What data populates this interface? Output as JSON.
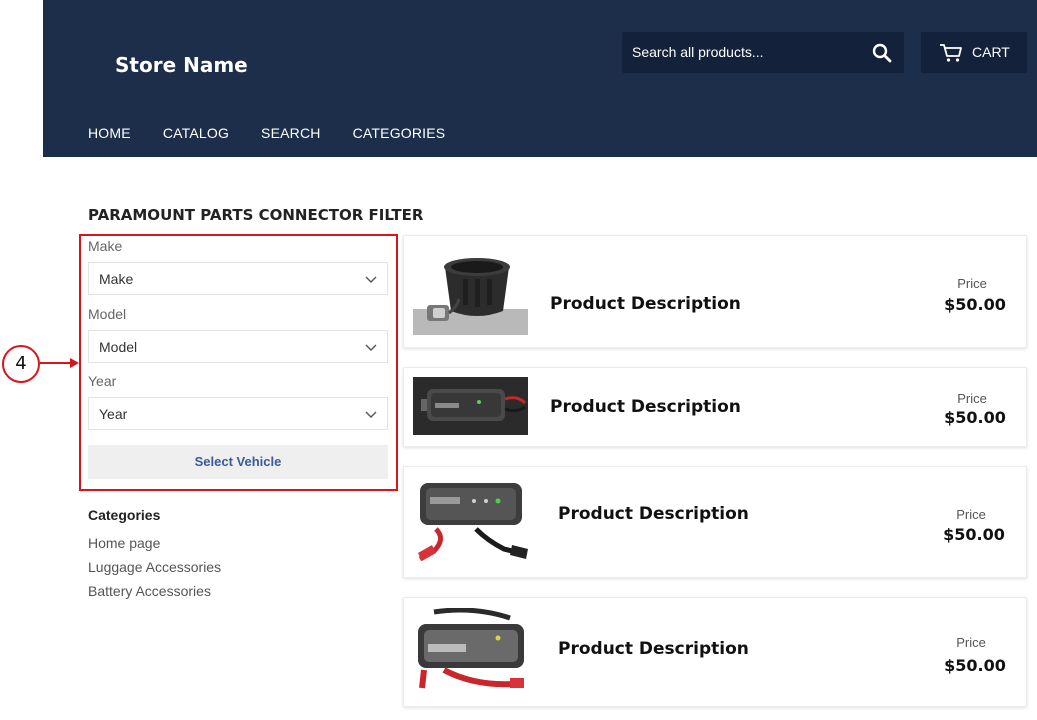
{
  "header": {
    "store_name": "Store Name",
    "search_placeholder": "Search all products...",
    "cart_label": "CART",
    "nav": [
      "HOME",
      "CATALOG",
      "SEARCH",
      "CATEGORIES"
    ],
    "background_color": "#1c2e4a"
  },
  "filter": {
    "title": "PARAMOUNT PARTS CONNECTOR FILTER",
    "make_label": "Make",
    "make_value": "Make",
    "model_label": "Model",
    "model_value": "Model",
    "year_label": "Year",
    "year_value": "Year",
    "button_label": "Select Vehicle",
    "annotation_number": "4",
    "annotation_color": "#d9141b"
  },
  "categories": {
    "title": "Categories",
    "items": [
      "Home page",
      "Luggage Accessories",
      "Battery Accessories"
    ]
  },
  "products": [
    {
      "description": "Product Description",
      "price_label": "Price",
      "price": "$50.00",
      "image": "connector-cup-image"
    },
    {
      "description": "Product Description",
      "price_label": "Price",
      "price": "$50.00",
      "image": "jump-starter-image"
    },
    {
      "description": "Product Description",
      "price_label": "Price",
      "price": "$50.00",
      "image": "noco-booster-clamps-image"
    },
    {
      "description": "Product Description",
      "price_label": "Price",
      "price": "$50.00",
      "image": "genius-boost-hd-image"
    }
  ]
}
